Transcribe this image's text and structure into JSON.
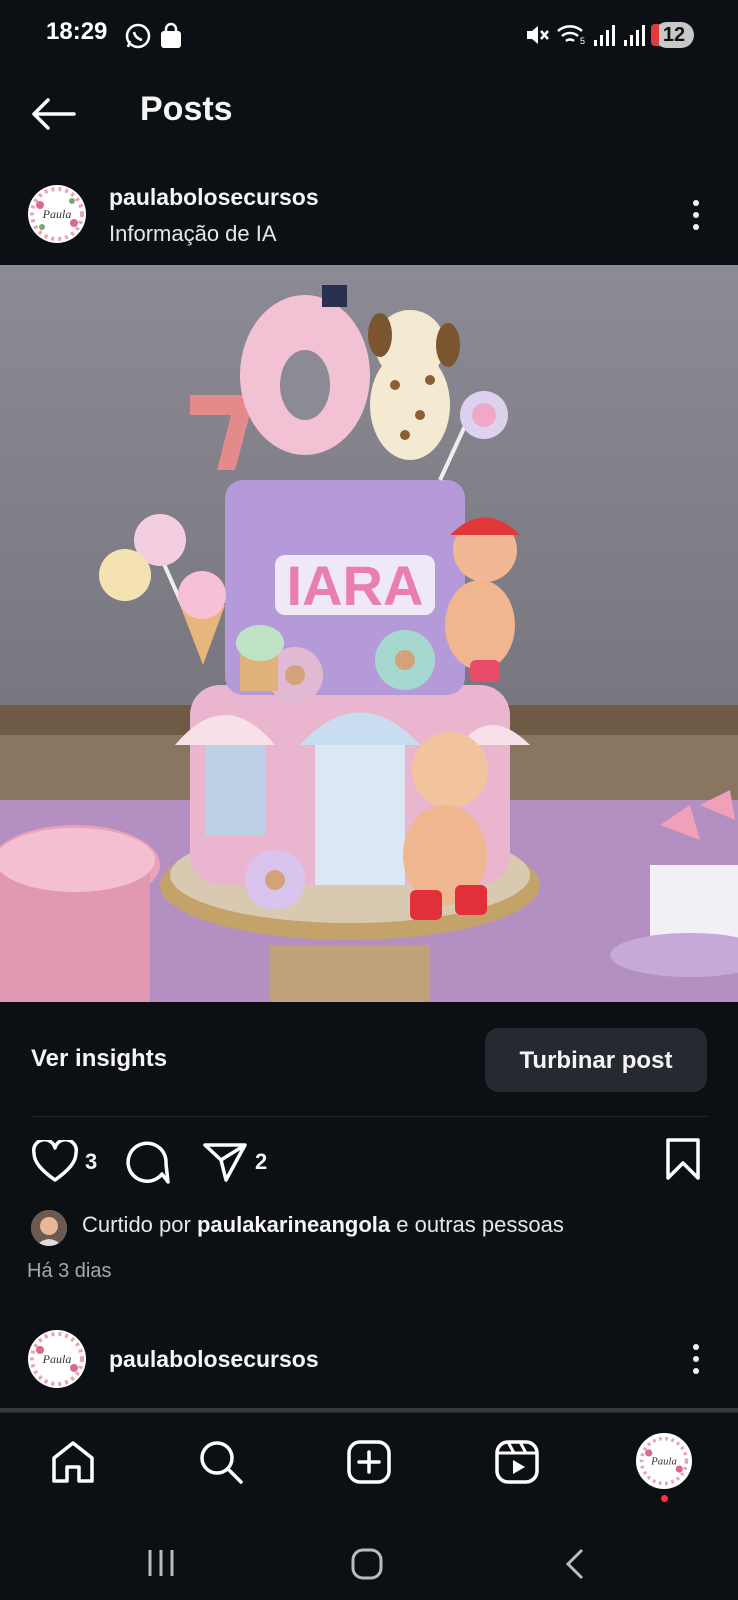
{
  "status_bar": {
    "time": "18:29",
    "notification_count": "12",
    "icons": [
      "whatsapp-icon",
      "shopping-bag-icon",
      "mute-icon",
      "wifi-icon",
      "signal-icon",
      "signal-icon"
    ]
  },
  "header": {
    "title": "Posts",
    "back_icon": "arrow-left-icon"
  },
  "post": {
    "username": "paulabolosecursos",
    "subtitle": "Informação de IA",
    "avatar_text": "Paula",
    "photo_caption_text": "IARA",
    "insights_label": "Ver insights",
    "boost_label": "Turbinar post",
    "likes_count": "3",
    "shares_count": "2",
    "liked_by_prefix": "Curtido por",
    "liked_by_user": "paulakarineangola",
    "liked_by_suffix": "e outras pessoas",
    "time_ago": "Há 3 dias"
  },
  "next_post": {
    "username": "paulabolosecursos"
  },
  "bottom_nav": [
    "home-icon",
    "search-icon",
    "create-icon",
    "reels-icon",
    "profile-avatar"
  ],
  "colors": {
    "background": "#0c1014",
    "button": "#262a30",
    "notification_dot": "#ff3040"
  }
}
